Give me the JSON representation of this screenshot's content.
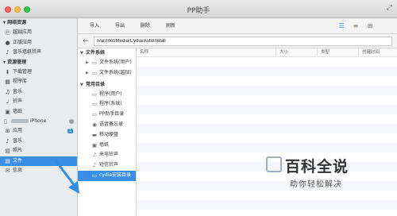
{
  "window": {
    "title": "PP助手"
  },
  "sidebar": {
    "sections": [
      {
        "title": "网络资源",
        "items": [
          {
            "label": "越狱应用",
            "icon": "store-icon"
          },
          {
            "label": "正版应用",
            "icon": "apple-icon"
          },
          {
            "label": "音乐墙纸铃声",
            "icon": "music-icon"
          }
        ]
      },
      {
        "title": "资源管理",
        "items": [
          {
            "label": "下载管理",
            "icon": "download-icon"
          },
          {
            "label": "程序库",
            "icon": "library-icon"
          },
          {
            "label": "音乐",
            "icon": "music-icon"
          },
          {
            "label": "铃声",
            "icon": "bell-icon"
          },
          {
            "label": "墙纸",
            "icon": "image-icon"
          }
        ]
      }
    ],
    "device": {
      "name_suffix": "iPhone"
    },
    "device_items": [
      {
        "label": "应用",
        "icon": "apps-icon",
        "badge": "1"
      },
      {
        "label": "音乐",
        "icon": "music-icon"
      },
      {
        "label": "照片",
        "icon": "photo-icon"
      },
      {
        "label": "文件",
        "icon": "folder-icon",
        "active": true
      },
      {
        "label": "信息",
        "icon": "message-icon"
      }
    ]
  },
  "toolbar": {
    "import_label": "导入",
    "export_label": "导出",
    "delete_label": "删除",
    "refresh_label": "刷新"
  },
  "path": {
    "value": "/var/root/Media/Cydia/AutoInstall"
  },
  "tree": {
    "filesystem_group": "文件系统",
    "filesystem_items": [
      {
        "label": "文件系统(用户)"
      },
      {
        "label": "文件系统(越狱)"
      }
    ],
    "common_group": "常用目录",
    "common_items": [
      {
        "label": "程序(用户)",
        "icon": "folder-icon"
      },
      {
        "label": "程序(系统)",
        "icon": "folder-icon"
      },
      {
        "label": "PP助手目录",
        "icon": "folder-icon"
      },
      {
        "label": "语音备忘录",
        "icon": "mic-icon"
      },
      {
        "label": "移动硬盘",
        "icon": "drive-icon"
      },
      {
        "label": "墙纸",
        "icon": "image-icon"
      },
      {
        "label": "来电铃声",
        "icon": "bell-icon"
      },
      {
        "label": "短信铃声",
        "icon": "bell-icon"
      },
      {
        "label": "cydia安装目录",
        "icon": "folder-icon",
        "active": true
      }
    ]
  },
  "filelist": {
    "columns": [
      "名称",
      "大小",
      "类型",
      "创建时间"
    ]
  },
  "watermark": {
    "title": "百科全说",
    "subtitle": "助你轻松解决"
  },
  "colors": {
    "accent": "#3a8ee6",
    "annotation_arrow": "#2f8de6"
  }
}
